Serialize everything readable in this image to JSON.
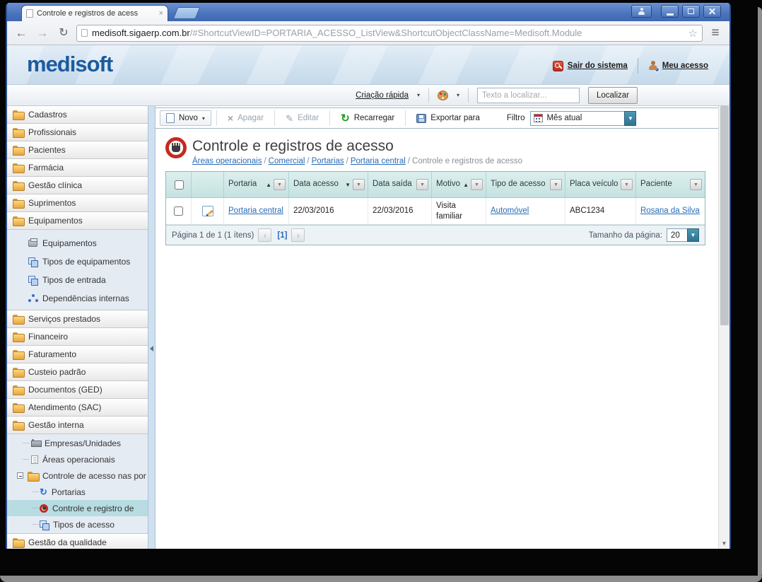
{
  "browser": {
    "tab_title": "Controle e registros de acess",
    "url_domain": "medisoft.sigaerp.com.br",
    "url_path": "/#ShortcutViewID=PORTARIA_ACESSO_ListView&ShortcutObjectClassName=Medisoft.Module"
  },
  "icons": {
    "back": "←",
    "forward": "→",
    "reload": "↻",
    "star": "☆",
    "menu": "≡",
    "dropdown": "▼",
    "dropdown_small": "▾",
    "prev": "‹",
    "next": "›",
    "close": "×",
    "delete_x": "×",
    "edit_pencil": "✎",
    "reload_green": "↻",
    "sync": "↻",
    "scroll_down": "▼"
  },
  "appbar": {
    "logo": "medisoft",
    "logout": "Sair do sistema",
    "my_access": "Meu acesso"
  },
  "quickbar": {
    "quick_create": "Criação rápida",
    "search_placeholder": "Texto a localizar...",
    "search_button": "Localizar"
  },
  "sidebar": {
    "groups": [
      {
        "label": "Cadastros"
      },
      {
        "label": "Profissionais"
      },
      {
        "label": "Pacientes"
      },
      {
        "label": "Farmácia"
      },
      {
        "label": "Gestão clínica"
      },
      {
        "label": "Suprimentos"
      },
      {
        "label": "Equipamentos"
      },
      {
        "label": "Serviços prestados"
      },
      {
        "label": "Financeiro"
      },
      {
        "label": "Faturamento"
      },
      {
        "label": "Custeio padrão"
      },
      {
        "label": "Documentos (GED)"
      },
      {
        "label": "Atendimento (SAC)"
      },
      {
        "label": "Gestão interna"
      },
      {
        "label": "Gestão da qualidade"
      }
    ],
    "equip_items": [
      {
        "label": "Equipamentos"
      },
      {
        "label": "Tipos de equipamentos"
      },
      {
        "label": "Tipos de entrada"
      },
      {
        "label": "Dependências internas"
      }
    ],
    "gestao_items": [
      {
        "label": "Empresas/Unidades"
      },
      {
        "label": "Áreas operacionais"
      },
      {
        "label": "Controle de acesso nas por"
      },
      {
        "label": "Portarias"
      },
      {
        "label": "Controle e registro de"
      },
      {
        "label": "Tipos de acesso"
      }
    ]
  },
  "toolbar": {
    "new": "Novo",
    "delete": "Apagar",
    "edit": "Editar",
    "reload": "Recarregar",
    "export": "Exportar para",
    "filter_label": "Filtro",
    "filter_value": "Mês atual"
  },
  "view": {
    "title": "Controle e registros de acesso",
    "sep": "/",
    "breadcrumb": [
      {
        "label": "Áreas operacionais"
      },
      {
        "label": "Comercial"
      },
      {
        "label": "Portarias"
      },
      {
        "label": "Portaria central"
      },
      {
        "label": "Controle e registros de acesso"
      }
    ]
  },
  "table": {
    "columns": [
      {
        "label": "Portaria",
        "sort": "▲"
      },
      {
        "label": "Data acesso",
        "sort": "▼"
      },
      {
        "label": "Data saída",
        "sort": ""
      },
      {
        "label": "Motivo",
        "sort": "▲"
      },
      {
        "label": "Tipo de acesso",
        "sort": ""
      },
      {
        "label": "Placa veículo",
        "sort": ""
      },
      {
        "label": "Paciente",
        "sort": ""
      }
    ],
    "row": {
      "portaria": "Portaria central",
      "data_acesso": "22/03/2016",
      "data_saida": "22/03/2016",
      "motivo": "Visita familiar",
      "tipo_acesso": "Automóvel",
      "placa": "ABC1234",
      "paciente": "Rosana da Silva"
    }
  },
  "pager": {
    "summary": "Página 1 de 1 (1 ítens)",
    "current": "[1]",
    "size_label": "Tamanho da página:",
    "size_value": "20"
  },
  "colors": {
    "logo_blue": "#1d5b9e",
    "link_blue": "#2a6cb5",
    "header_teal": "#cde8e7",
    "accent_teal": "#3f8faa",
    "selected_nav": "#b7dce2"
  }
}
